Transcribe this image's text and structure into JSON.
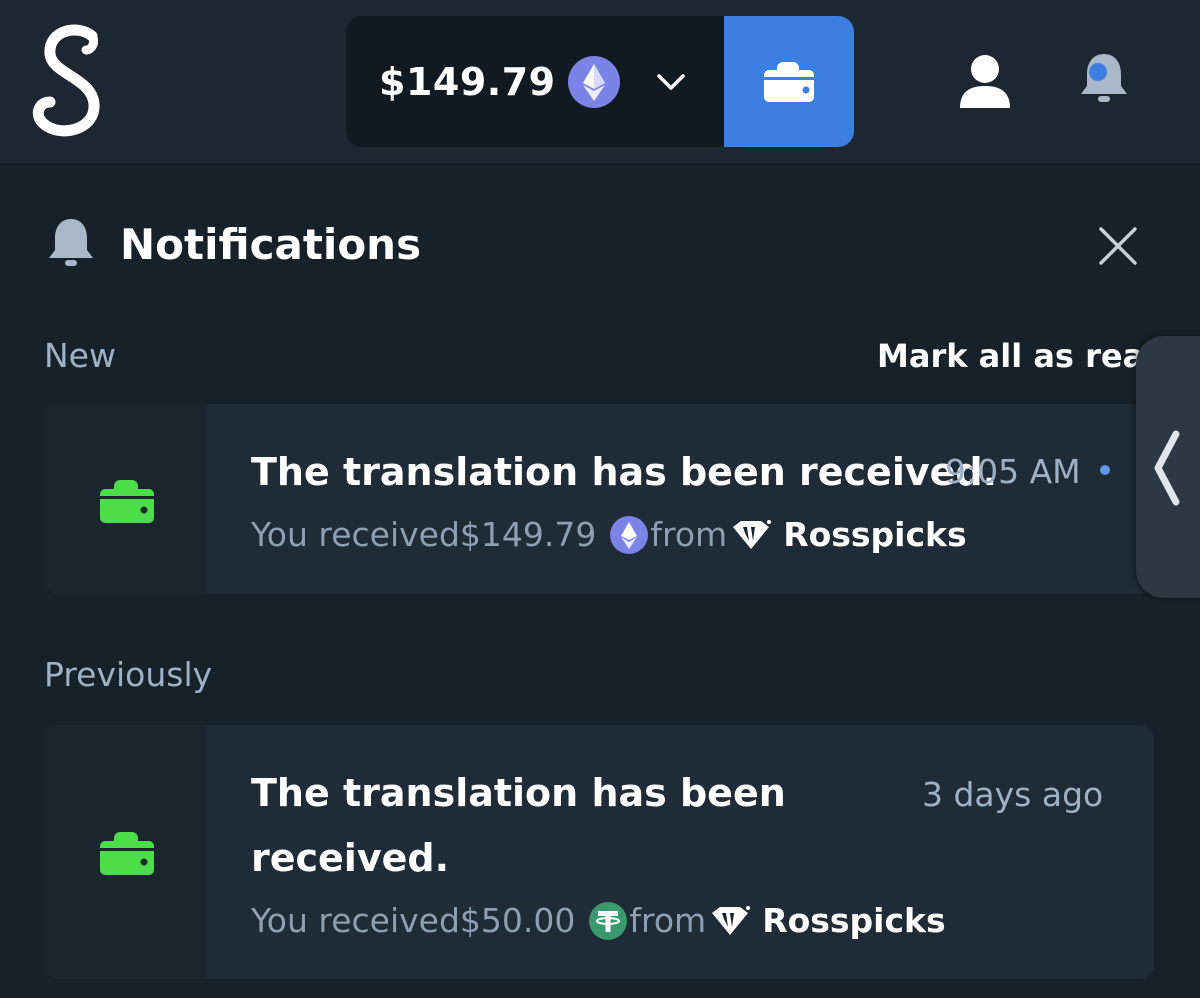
{
  "header": {
    "logo_icon": "script-s-logo",
    "balance": "$149.79",
    "currency_icon": "ethereum-icon",
    "dropdown_icon": "chevron-down-icon",
    "wallet_icon": "wallet-icon",
    "user_icon": "user-icon",
    "notifications_icon": "bell-icon",
    "colors": {
      "accent": "#3d7fe0",
      "ethereum": "#7b83e6"
    }
  },
  "panel": {
    "title": "Notifications",
    "close_icon": "close-icon",
    "new_label": "New",
    "mark_all_label": "Mark all as read",
    "previously_label": "Previously"
  },
  "notifications": [
    {
      "title": "The translation has been received.",
      "time": "9:05 AM",
      "unread": true,
      "prefix": "You received",
      "amount": "$149.79",
      "coin_icon": "ethereum-icon",
      "from": "from",
      "sender": "Rosspicks",
      "sender_icon": "diamond-icon"
    },
    {
      "title_line1": "The translation has been",
      "title_line2": "received.",
      "time": "3 days ago",
      "unread": false,
      "prefix": "You received",
      "amount": "$50.00",
      "coin_icon": "tether-icon",
      "from": "from",
      "sender": "Rosspicks",
      "sender_icon": "diamond-icon"
    }
  ],
  "colors": {
    "background": "#172129",
    "card": "#1f2b36",
    "success_green": "#4ddc4a",
    "tether": "#3a9a6e",
    "muted_text": "#9fb1c4"
  }
}
